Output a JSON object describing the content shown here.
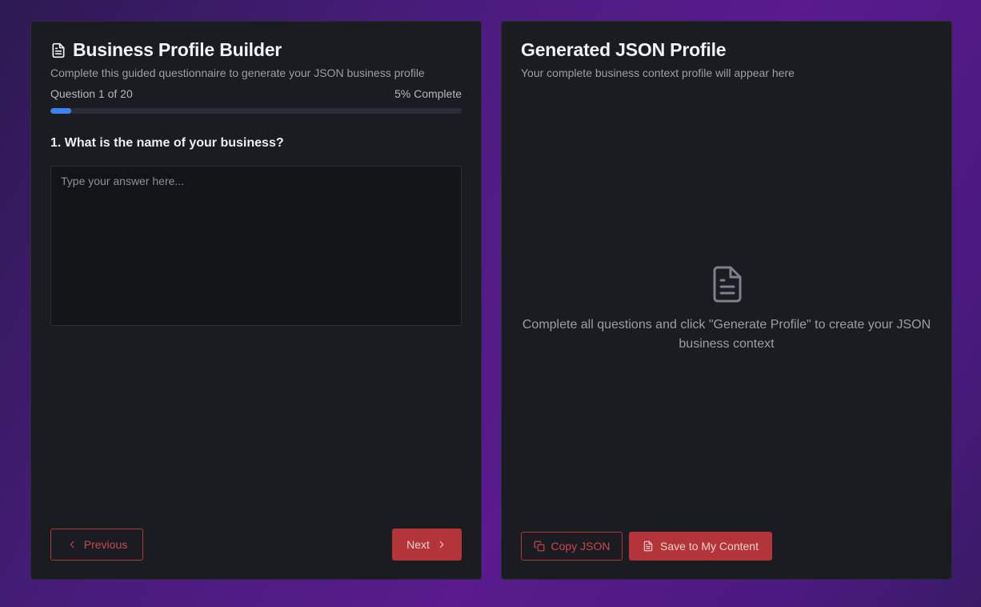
{
  "builder": {
    "title": "Business Profile Builder",
    "subtitle": "Complete this guided questionnaire to generate your JSON business profile",
    "question_counter": "Question 1 of 20",
    "percent_label": "5% Complete",
    "progress_fraction": 0.05,
    "question": "1. What is the name of your business?",
    "answer_value": "",
    "answer_placeholder": "Type your answer here...",
    "previous_label": "Previous",
    "next_label": "Next"
  },
  "output": {
    "title": "Generated JSON Profile",
    "subtitle": "Your complete business context profile will appear here",
    "empty_message": "Complete all questions and click \"Generate Profile\" to create your JSON business context",
    "copy_label": "Copy JSON",
    "save_label": "Save to My Content"
  },
  "icons": {
    "title_icon": "file-text-icon",
    "empty_icon": "file-text-icon",
    "previous_icon": "chevron-left-icon",
    "next_icon": "chevron-right-icon",
    "copy_icon": "copy-icon",
    "save_icon": "file-text-icon"
  },
  "colors": {
    "accent": "#b3353a",
    "progress": "#3b82f6",
    "panel": "#1a1c21"
  }
}
